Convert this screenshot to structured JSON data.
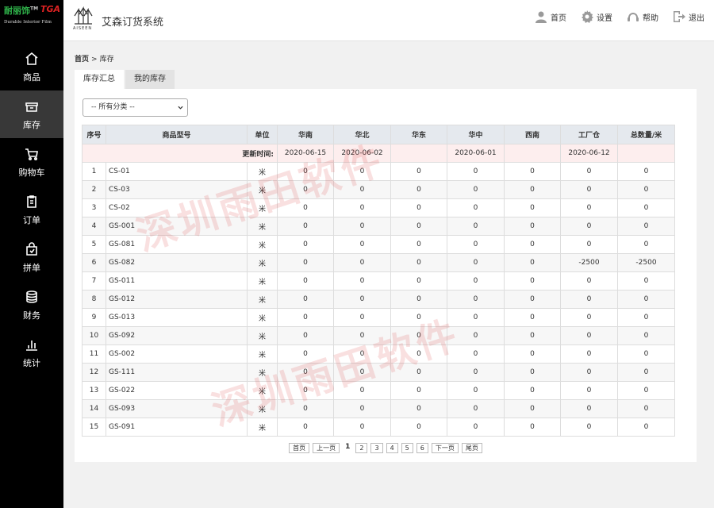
{
  "brand": {
    "name": "耐丽饰",
    "mark": "TM",
    "tga": "TGA",
    "tagline": "Durable Interior Film"
  },
  "nav": [
    {
      "label": "商品",
      "icon": "home-icon",
      "active": false
    },
    {
      "label": "库存",
      "icon": "inventory-icon",
      "active": true
    },
    {
      "label": "购物车",
      "icon": "cart-icon",
      "active": false
    },
    {
      "label": "订单",
      "icon": "order-icon",
      "active": false
    },
    {
      "label": "拼单",
      "icon": "group-order-icon",
      "active": false
    },
    {
      "label": "财务",
      "icon": "finance-icon",
      "active": false
    },
    {
      "label": "统计",
      "icon": "statistics-icon",
      "active": false
    }
  ],
  "header": {
    "logo_text": "AISEEN",
    "system_name": "艾森订货系统",
    "actions": [
      {
        "label": "首页",
        "icon": "user-icon"
      },
      {
        "label": "设置",
        "icon": "gear-icon"
      },
      {
        "label": "帮助",
        "icon": "headset-icon"
      },
      {
        "label": "退出",
        "icon": "logout-icon"
      }
    ]
  },
  "breadcrumb": {
    "home": "首页",
    "separator": ">",
    "current": "库存"
  },
  "tabs": [
    {
      "label": "库存汇总",
      "active": true
    },
    {
      "label": "我的库存",
      "active": false
    }
  ],
  "filter": {
    "selected": "-- 所有分类 --"
  },
  "table": {
    "headers": [
      "序号",
      "商品型号",
      "单位",
      "华南",
      "华北",
      "华东",
      "华中",
      "西南",
      "工厂仓",
      "总数量/米"
    ],
    "update_row": {
      "label": "更新时间:",
      "dates": [
        "2020-06-15",
        "2020-06-02",
        "",
        "2020-06-01",
        "",
        "2020-06-12",
        ""
      ]
    },
    "rows": [
      [
        "1",
        "CS-01",
        "米",
        "0",
        "0",
        "0",
        "0",
        "0",
        "0",
        "0"
      ],
      [
        "2",
        "CS-03",
        "米",
        "0",
        "0",
        "0",
        "0",
        "0",
        "0",
        "0"
      ],
      [
        "3",
        "CS-02",
        "米",
        "0",
        "0",
        "0",
        "0",
        "0",
        "0",
        "0"
      ],
      [
        "4",
        "GS-001",
        "米",
        "0",
        "0",
        "0",
        "0",
        "0",
        "0",
        "0"
      ],
      [
        "5",
        "GS-081",
        "米",
        "0",
        "0",
        "0",
        "0",
        "0",
        "0",
        "0"
      ],
      [
        "6",
        "GS-082",
        "米",
        "0",
        "0",
        "0",
        "0",
        "0",
        "-2500",
        "-2500"
      ],
      [
        "7",
        "GS-011",
        "米",
        "0",
        "0",
        "0",
        "0",
        "0",
        "0",
        "0"
      ],
      [
        "8",
        "GS-012",
        "米",
        "0",
        "0",
        "0",
        "0",
        "0",
        "0",
        "0"
      ],
      [
        "9",
        "GS-013",
        "米",
        "0",
        "0",
        "0",
        "0",
        "0",
        "0",
        "0"
      ],
      [
        "10",
        "GS-092",
        "米",
        "0",
        "0",
        "0",
        "0",
        "0",
        "0",
        "0"
      ],
      [
        "11",
        "GS-002",
        "米",
        "0",
        "0",
        "0",
        "0",
        "0",
        "0",
        "0"
      ],
      [
        "12",
        "GS-111",
        "米",
        "0",
        "0",
        "0",
        "0",
        "0",
        "0",
        "0"
      ],
      [
        "13",
        "GS-022",
        "米",
        "0",
        "0",
        "0",
        "0",
        "0",
        "0",
        "0"
      ],
      [
        "14",
        "GS-093",
        "米",
        "0",
        "0",
        "0",
        "0",
        "0",
        "0",
        "0"
      ],
      [
        "15",
        "GS-091",
        "米",
        "0",
        "0",
        "0",
        "0",
        "0",
        "0",
        "0"
      ]
    ]
  },
  "pagination": {
    "first": "首页",
    "prev": "上一页",
    "current": "1",
    "pages": [
      "2",
      "3",
      "4",
      "5",
      "6"
    ],
    "next": "下一页",
    "last": "尾页"
  },
  "watermark": "深圳雨田软件"
}
